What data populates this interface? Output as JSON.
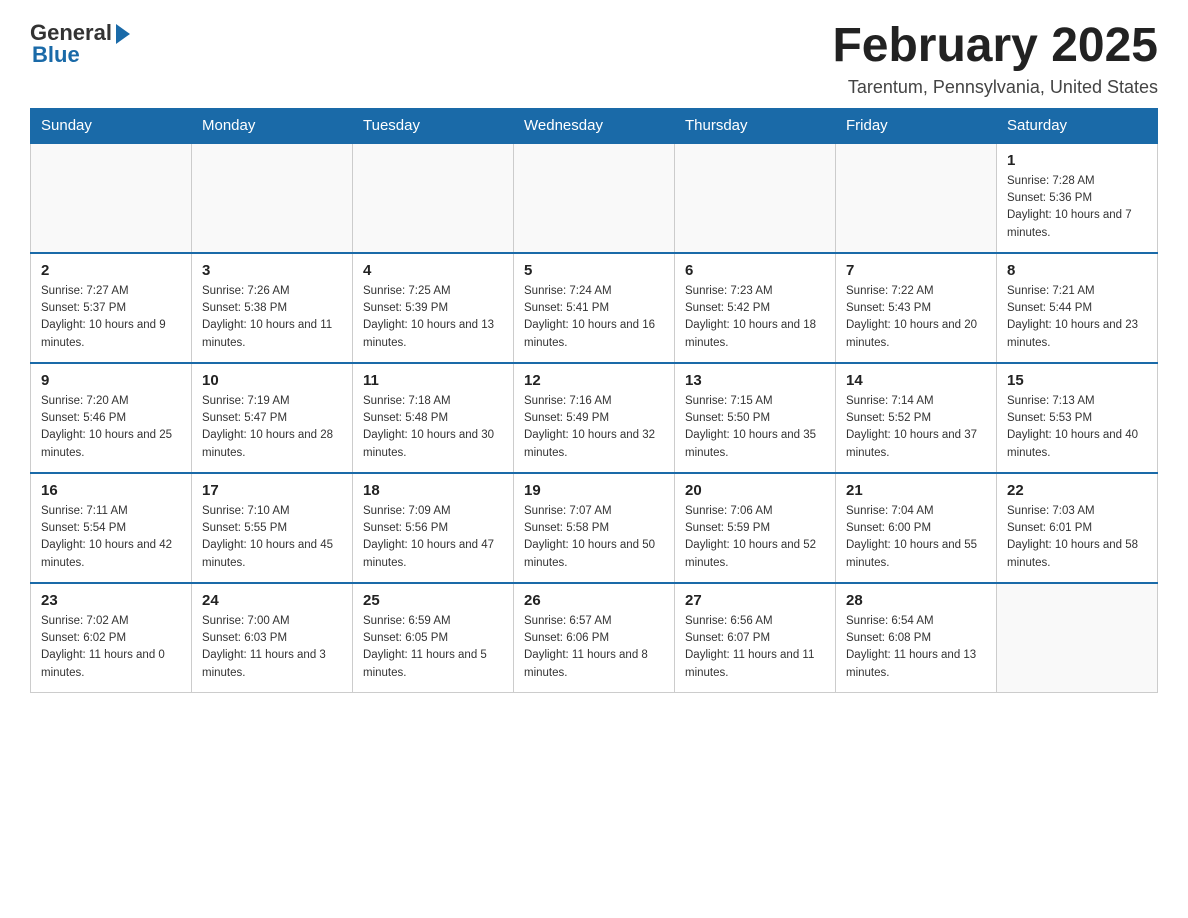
{
  "header": {
    "logo_general": "General",
    "logo_blue": "Blue",
    "month_title": "February 2025",
    "location": "Tarentum, Pennsylvania, United States"
  },
  "days_of_week": [
    "Sunday",
    "Monday",
    "Tuesday",
    "Wednesday",
    "Thursday",
    "Friday",
    "Saturday"
  ],
  "weeks": [
    {
      "days": [
        {
          "number": "",
          "info": ""
        },
        {
          "number": "",
          "info": ""
        },
        {
          "number": "",
          "info": ""
        },
        {
          "number": "",
          "info": ""
        },
        {
          "number": "",
          "info": ""
        },
        {
          "number": "",
          "info": ""
        },
        {
          "number": "1",
          "info": "Sunrise: 7:28 AM\nSunset: 5:36 PM\nDaylight: 10 hours and 7 minutes."
        }
      ]
    },
    {
      "days": [
        {
          "number": "2",
          "info": "Sunrise: 7:27 AM\nSunset: 5:37 PM\nDaylight: 10 hours and 9 minutes."
        },
        {
          "number": "3",
          "info": "Sunrise: 7:26 AM\nSunset: 5:38 PM\nDaylight: 10 hours and 11 minutes."
        },
        {
          "number": "4",
          "info": "Sunrise: 7:25 AM\nSunset: 5:39 PM\nDaylight: 10 hours and 13 minutes."
        },
        {
          "number": "5",
          "info": "Sunrise: 7:24 AM\nSunset: 5:41 PM\nDaylight: 10 hours and 16 minutes."
        },
        {
          "number": "6",
          "info": "Sunrise: 7:23 AM\nSunset: 5:42 PM\nDaylight: 10 hours and 18 minutes."
        },
        {
          "number": "7",
          "info": "Sunrise: 7:22 AM\nSunset: 5:43 PM\nDaylight: 10 hours and 20 minutes."
        },
        {
          "number": "8",
          "info": "Sunrise: 7:21 AM\nSunset: 5:44 PM\nDaylight: 10 hours and 23 minutes."
        }
      ]
    },
    {
      "days": [
        {
          "number": "9",
          "info": "Sunrise: 7:20 AM\nSunset: 5:46 PM\nDaylight: 10 hours and 25 minutes."
        },
        {
          "number": "10",
          "info": "Sunrise: 7:19 AM\nSunset: 5:47 PM\nDaylight: 10 hours and 28 minutes."
        },
        {
          "number": "11",
          "info": "Sunrise: 7:18 AM\nSunset: 5:48 PM\nDaylight: 10 hours and 30 minutes."
        },
        {
          "number": "12",
          "info": "Sunrise: 7:16 AM\nSunset: 5:49 PM\nDaylight: 10 hours and 32 minutes."
        },
        {
          "number": "13",
          "info": "Sunrise: 7:15 AM\nSunset: 5:50 PM\nDaylight: 10 hours and 35 minutes."
        },
        {
          "number": "14",
          "info": "Sunrise: 7:14 AM\nSunset: 5:52 PM\nDaylight: 10 hours and 37 minutes."
        },
        {
          "number": "15",
          "info": "Sunrise: 7:13 AM\nSunset: 5:53 PM\nDaylight: 10 hours and 40 minutes."
        }
      ]
    },
    {
      "days": [
        {
          "number": "16",
          "info": "Sunrise: 7:11 AM\nSunset: 5:54 PM\nDaylight: 10 hours and 42 minutes."
        },
        {
          "number": "17",
          "info": "Sunrise: 7:10 AM\nSunset: 5:55 PM\nDaylight: 10 hours and 45 minutes."
        },
        {
          "number": "18",
          "info": "Sunrise: 7:09 AM\nSunset: 5:56 PM\nDaylight: 10 hours and 47 minutes."
        },
        {
          "number": "19",
          "info": "Sunrise: 7:07 AM\nSunset: 5:58 PM\nDaylight: 10 hours and 50 minutes."
        },
        {
          "number": "20",
          "info": "Sunrise: 7:06 AM\nSunset: 5:59 PM\nDaylight: 10 hours and 52 minutes."
        },
        {
          "number": "21",
          "info": "Sunrise: 7:04 AM\nSunset: 6:00 PM\nDaylight: 10 hours and 55 minutes."
        },
        {
          "number": "22",
          "info": "Sunrise: 7:03 AM\nSunset: 6:01 PM\nDaylight: 10 hours and 58 minutes."
        }
      ]
    },
    {
      "days": [
        {
          "number": "23",
          "info": "Sunrise: 7:02 AM\nSunset: 6:02 PM\nDaylight: 11 hours and 0 minutes."
        },
        {
          "number": "24",
          "info": "Sunrise: 7:00 AM\nSunset: 6:03 PM\nDaylight: 11 hours and 3 minutes."
        },
        {
          "number": "25",
          "info": "Sunrise: 6:59 AM\nSunset: 6:05 PM\nDaylight: 11 hours and 5 minutes."
        },
        {
          "number": "26",
          "info": "Sunrise: 6:57 AM\nSunset: 6:06 PM\nDaylight: 11 hours and 8 minutes."
        },
        {
          "number": "27",
          "info": "Sunrise: 6:56 AM\nSunset: 6:07 PM\nDaylight: 11 hours and 11 minutes."
        },
        {
          "number": "28",
          "info": "Sunrise: 6:54 AM\nSunset: 6:08 PM\nDaylight: 11 hours and 13 minutes."
        },
        {
          "number": "",
          "info": ""
        }
      ]
    }
  ]
}
